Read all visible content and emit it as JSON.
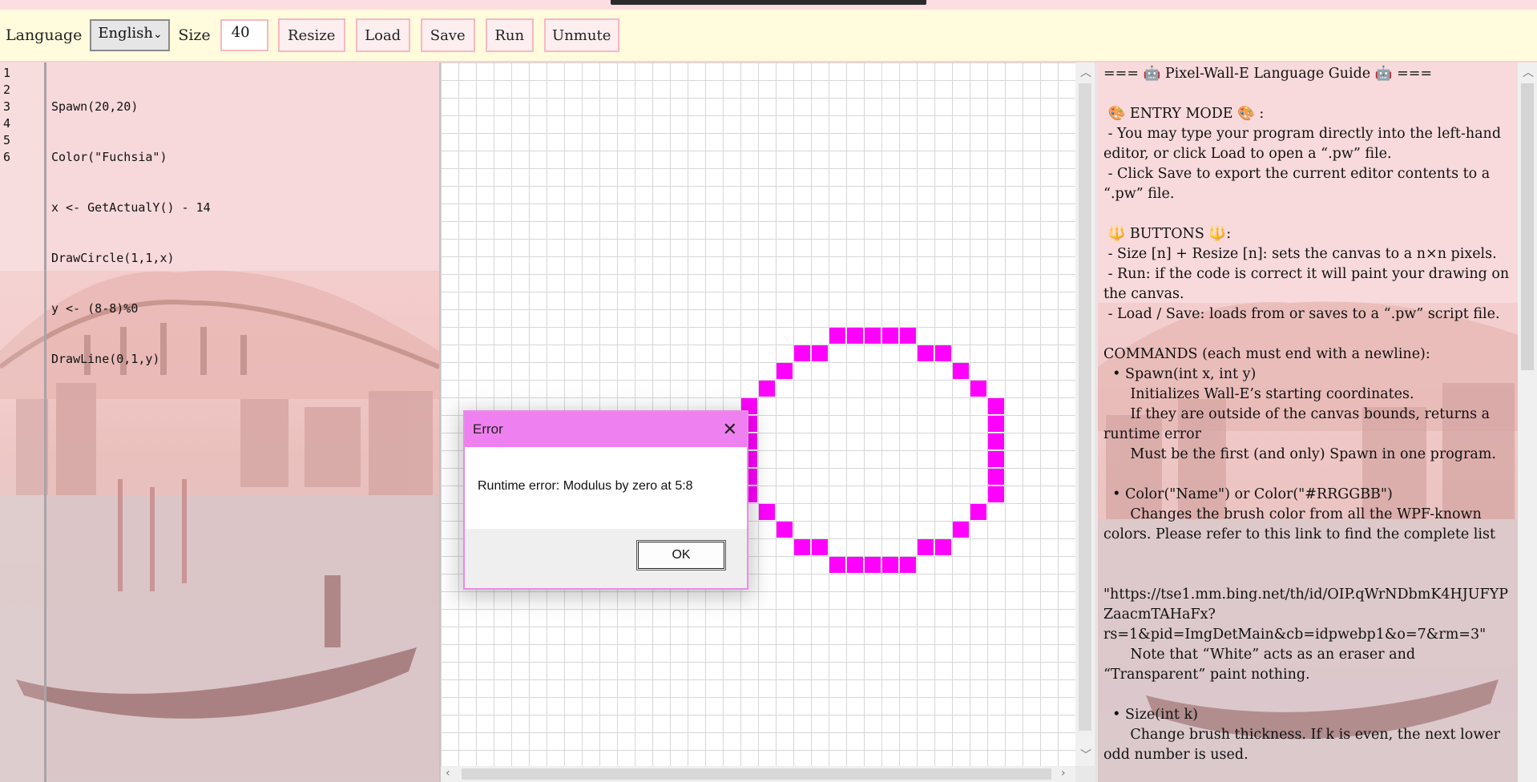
{
  "toolbar": {
    "language_label": "Language",
    "language_value": "English",
    "size_label": "Size",
    "size_value": "40",
    "buttons": [
      "Resize",
      "Load",
      "Save",
      "Run",
      "Unmute"
    ]
  },
  "editor": {
    "line_numbers": [
      "1",
      "2",
      "3",
      "4",
      "5",
      "6"
    ],
    "code_lines": [
      "Spawn(20,20)",
      "Color(\"Fuchsia\")",
      "x <- GetActualY() - 14",
      "DrawCircle(1,1,x)",
      "y <- (8-8)%0",
      "DrawLine(0,1,y)"
    ]
  },
  "canvas": {
    "brush_color": "#ff00ff",
    "grid_color": "#d7d7d7",
    "painted_cells": [
      [
        5,
        0
      ],
      [
        6,
        0
      ],
      [
        7,
        0
      ],
      [
        8,
        0
      ],
      [
        9,
        0
      ],
      [
        3,
        1
      ],
      [
        4,
        1
      ],
      [
        10,
        1
      ],
      [
        11,
        1
      ],
      [
        2,
        2
      ],
      [
        12,
        2
      ],
      [
        1,
        3
      ],
      [
        13,
        3
      ],
      [
        0,
        4
      ],
      [
        14,
        4
      ],
      [
        0,
        5
      ],
      [
        14,
        5
      ],
      [
        0,
        6
      ],
      [
        14,
        6
      ],
      [
        0,
        7
      ],
      [
        14,
        7
      ],
      [
        0,
        8
      ],
      [
        14,
        8
      ],
      [
        0,
        9
      ],
      [
        14,
        9
      ],
      [
        1,
        10
      ],
      [
        13,
        10
      ],
      [
        2,
        11
      ],
      [
        12,
        11
      ],
      [
        3,
        12
      ],
      [
        4,
        12
      ],
      [
        10,
        12
      ],
      [
        11,
        12
      ],
      [
        5,
        13
      ],
      [
        6,
        13
      ],
      [
        7,
        13
      ],
      [
        8,
        13
      ],
      [
        9,
        13
      ]
    ]
  },
  "dialog": {
    "title": "Error",
    "message": "Runtime error: Modulus by zero at 5:8",
    "ok_label": "OK"
  },
  "guide": {
    "text": "=== 🤖 Pixel-Wall-E Language Guide 🤖 ===\n\n 🎨 ENTRY MODE 🎨 :\n - You may type your program directly into the left-hand editor, or click Load to open a “.pw” file.\n - Click Save to export the current editor contents to a “.pw” file.\n\n 🔱 BUTTONS 🔱:\n - Size [n] + Resize [n]: sets the canvas to a n×n pixels.\n - Run: if the code is correct it will paint your drawing on the canvas.\n - Load / Save: loads from or saves to a “.pw” script file.\n\nCOMMANDS (each must end with a newline):\n  • Spawn(int x, int y)\n      Initializes Wall-E’s starting coordinates.\n      If they are outside of the canvas bounds, returns a runtime error\n      Must be the first (and only) Spawn in one program.\n\n  • Color(\"Name\") or Color(\"#RRGGBB\")\n      Changes the brush color from all the WPF-known colors. Please refer to this link to find the complete list\n\n      \"https://tse1.mm.bing.net/th/id/OIP.qWrNDbmK4HJUFYPZaacmTAHaFx?rs=1&pid=ImgDetMain&cb=idpwebp1&o=7&rm=3\"\n      Note that “White” acts as an eraser and “Transparent” paint nothing.\n\n  • Size(int k)\n      Change brush thickness. If k is even, the next lower odd number is used.\n\n  • DrawLine(dx, dy, distance)"
  }
}
